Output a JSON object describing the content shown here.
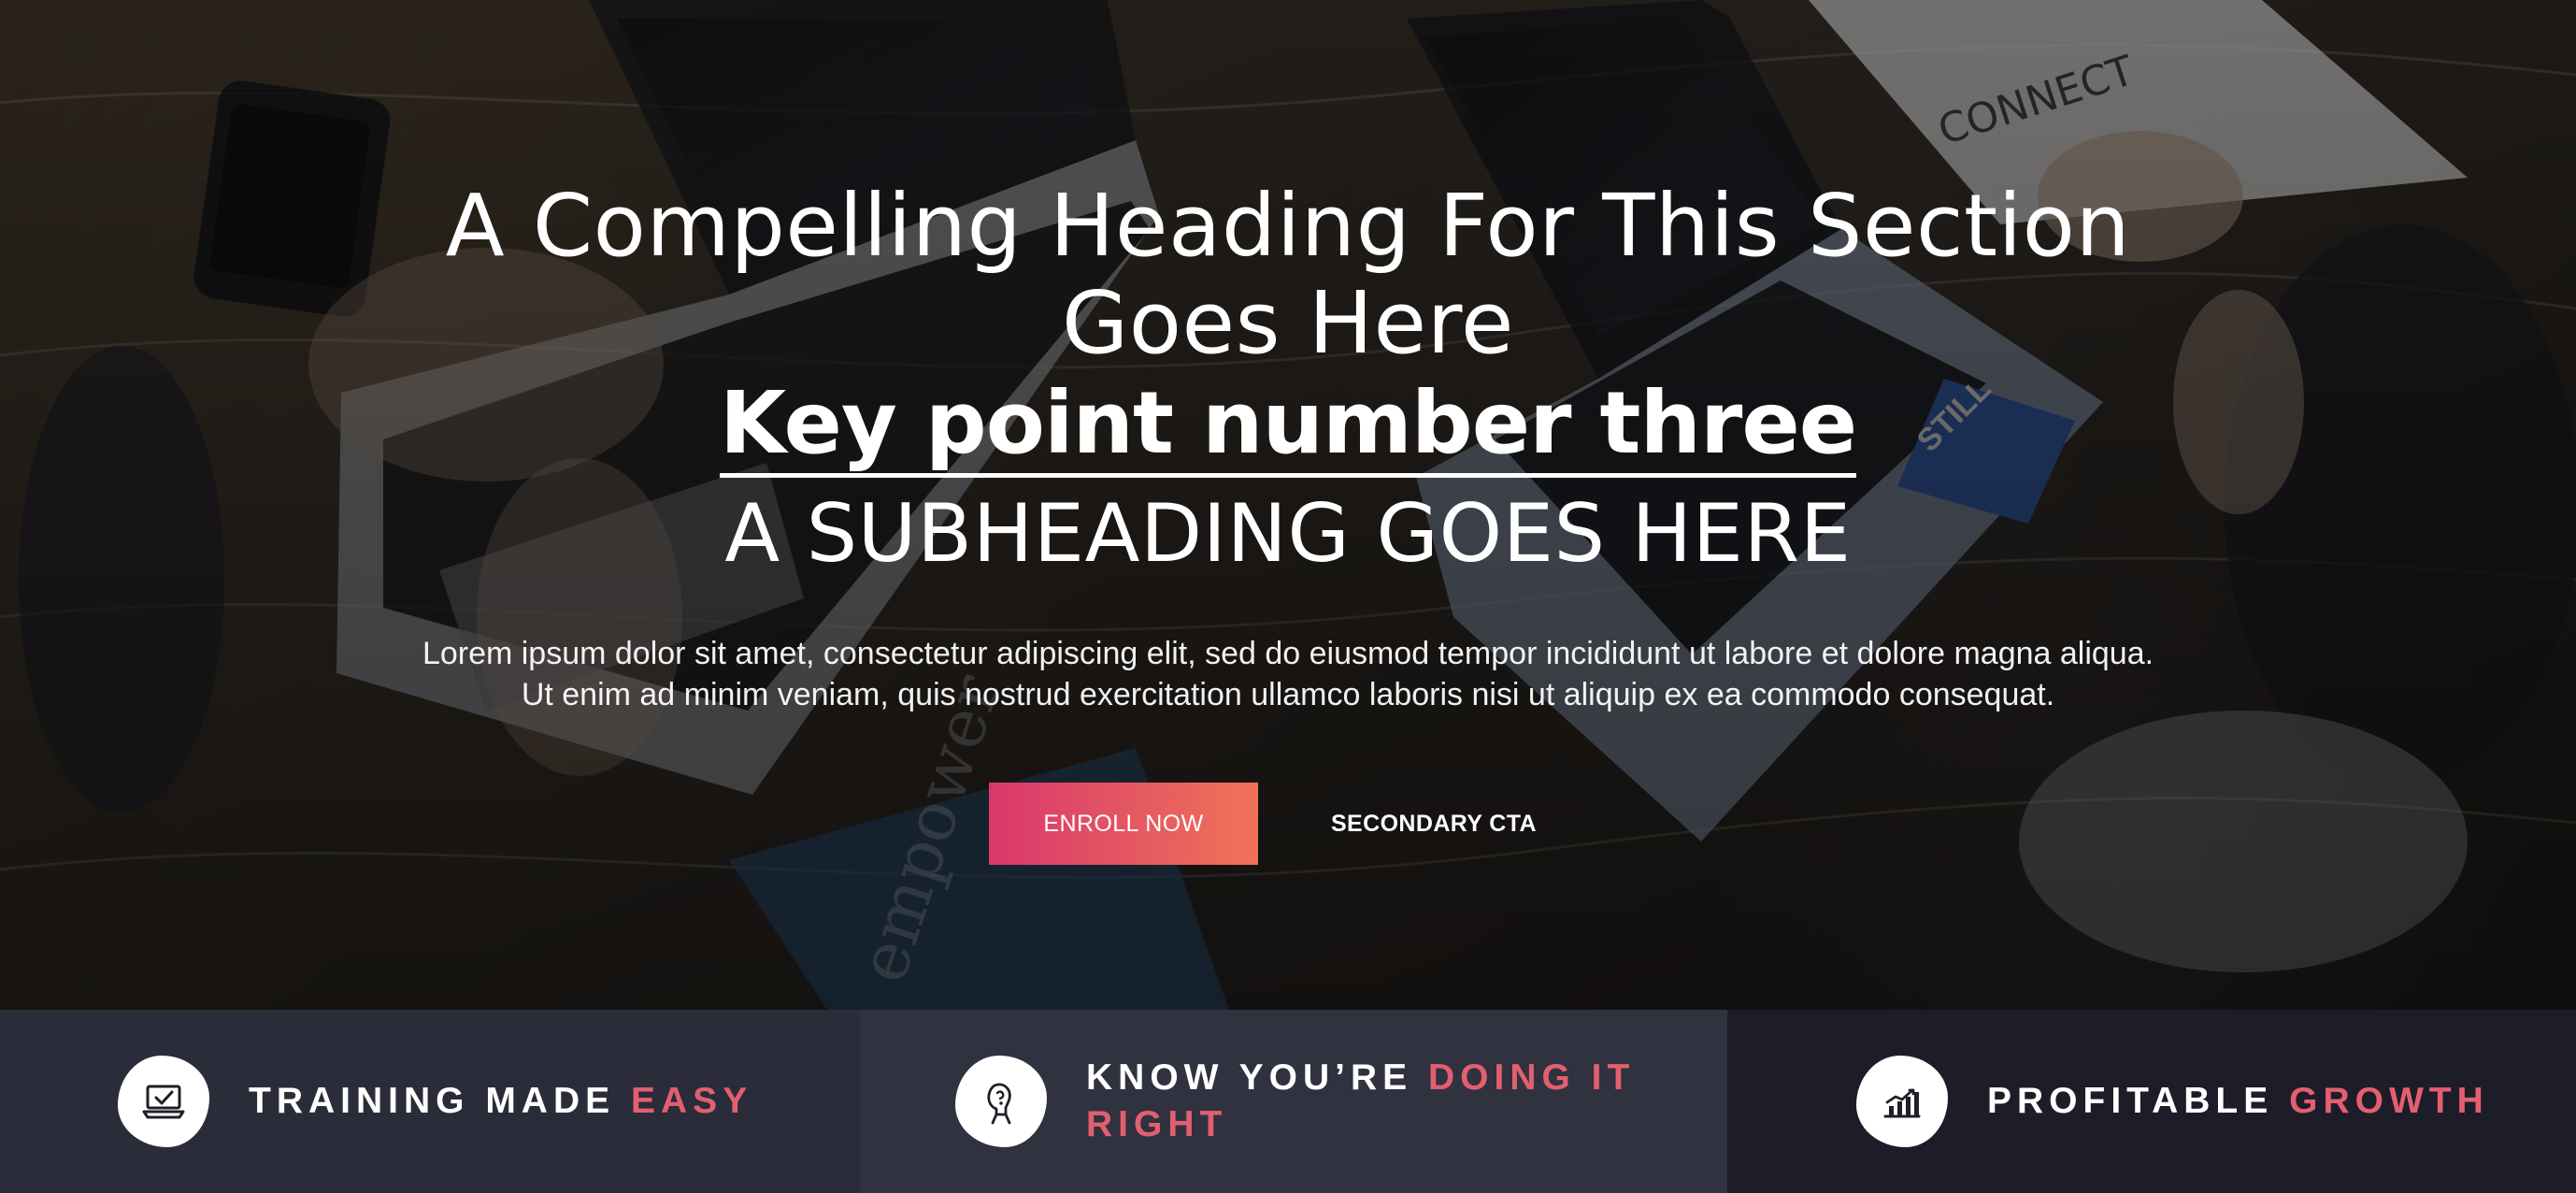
{
  "hero": {
    "headline_line1": "A Compelling Heading For This Section",
    "headline_line2": "Goes Here",
    "keypoint": "Key point number three",
    "subheading": "A SUBHEADING GOES HERE",
    "body": "Lorem ipsum dolor sit amet, consectetur adipiscing elit, sed do eiusmod tempor incididunt ut labore et dolore magna aliqua. Ut enim ad minim veniam, quis nostrud exercitation ullamco laboris nisi ut aliquip ex ea commodo consequat.",
    "primary_cta": "ENROLL NOW",
    "secondary_cta": "SECONDARY CTA"
  },
  "features": [
    {
      "text_before": "TRAINING MADE",
      "accent": "EASY",
      "icon": "laptop-check-icon"
    },
    {
      "text_before": "KNOW YOU’RE",
      "accent": "DOING IT RIGHT",
      "icon": "thinking-person-icon"
    },
    {
      "text_before": "PROFITABLE",
      "accent": "GROWTH",
      "icon": "growth-chart-icon"
    }
  ],
  "colors": {
    "accent": "#e35f6f",
    "button_gradient_start": "#d9386c",
    "button_gradient_end": "#ef7358",
    "feature_panel_1": "#2a2c39",
    "feature_panel_2": "#303240",
    "feature_panel_3": "#1c1d28"
  }
}
